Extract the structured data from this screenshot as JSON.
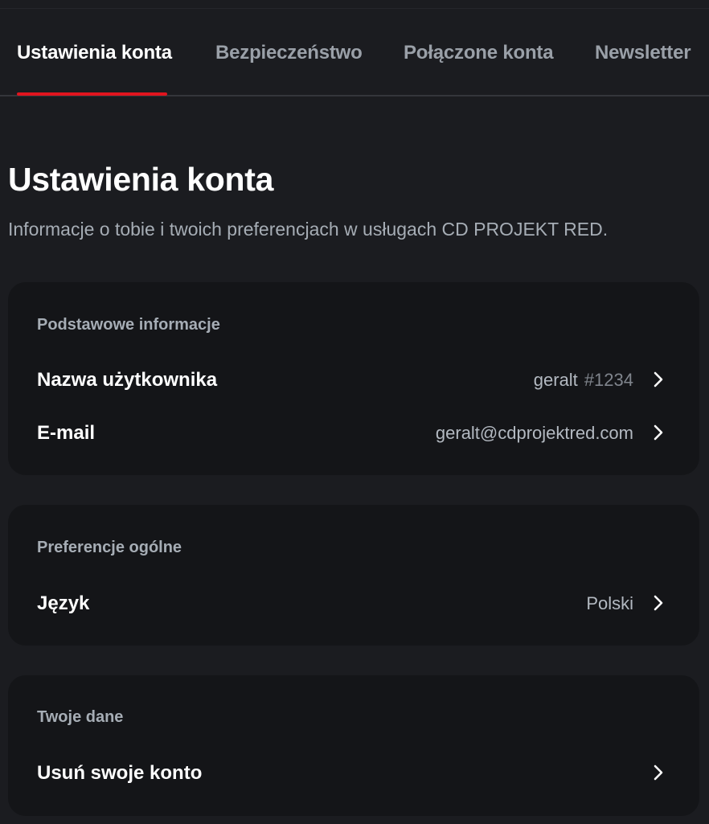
{
  "tabs": [
    {
      "label": "Ustawienia konta",
      "active": true
    },
    {
      "label": "Bezpieczeństwo",
      "active": false
    },
    {
      "label": "Połączone konta",
      "active": false
    },
    {
      "label": "Newsletter",
      "active": false
    }
  ],
  "accent_color": "#e0141e",
  "page": {
    "title": "Ustawienia konta",
    "subtitle": "Informacje o tobie i twoich preferencjach w usługach CD PROJEKT RED."
  },
  "basic_info": {
    "heading": "Podstawowe informacje",
    "username": {
      "label": "Nazwa użytkownika",
      "value": "geralt",
      "tag": "#1234"
    },
    "email": {
      "label": "E-mail",
      "value": "geralt@cdprojektred.com"
    }
  },
  "general_prefs": {
    "heading": "Preferencje ogólne",
    "language": {
      "label": "Język",
      "value": "Polski"
    }
  },
  "your_data": {
    "heading": "Twoje dane",
    "delete_account": {
      "label": "Usuń swoje konto"
    }
  },
  "icons": {
    "row_arrow": "chevron-right-icon"
  }
}
